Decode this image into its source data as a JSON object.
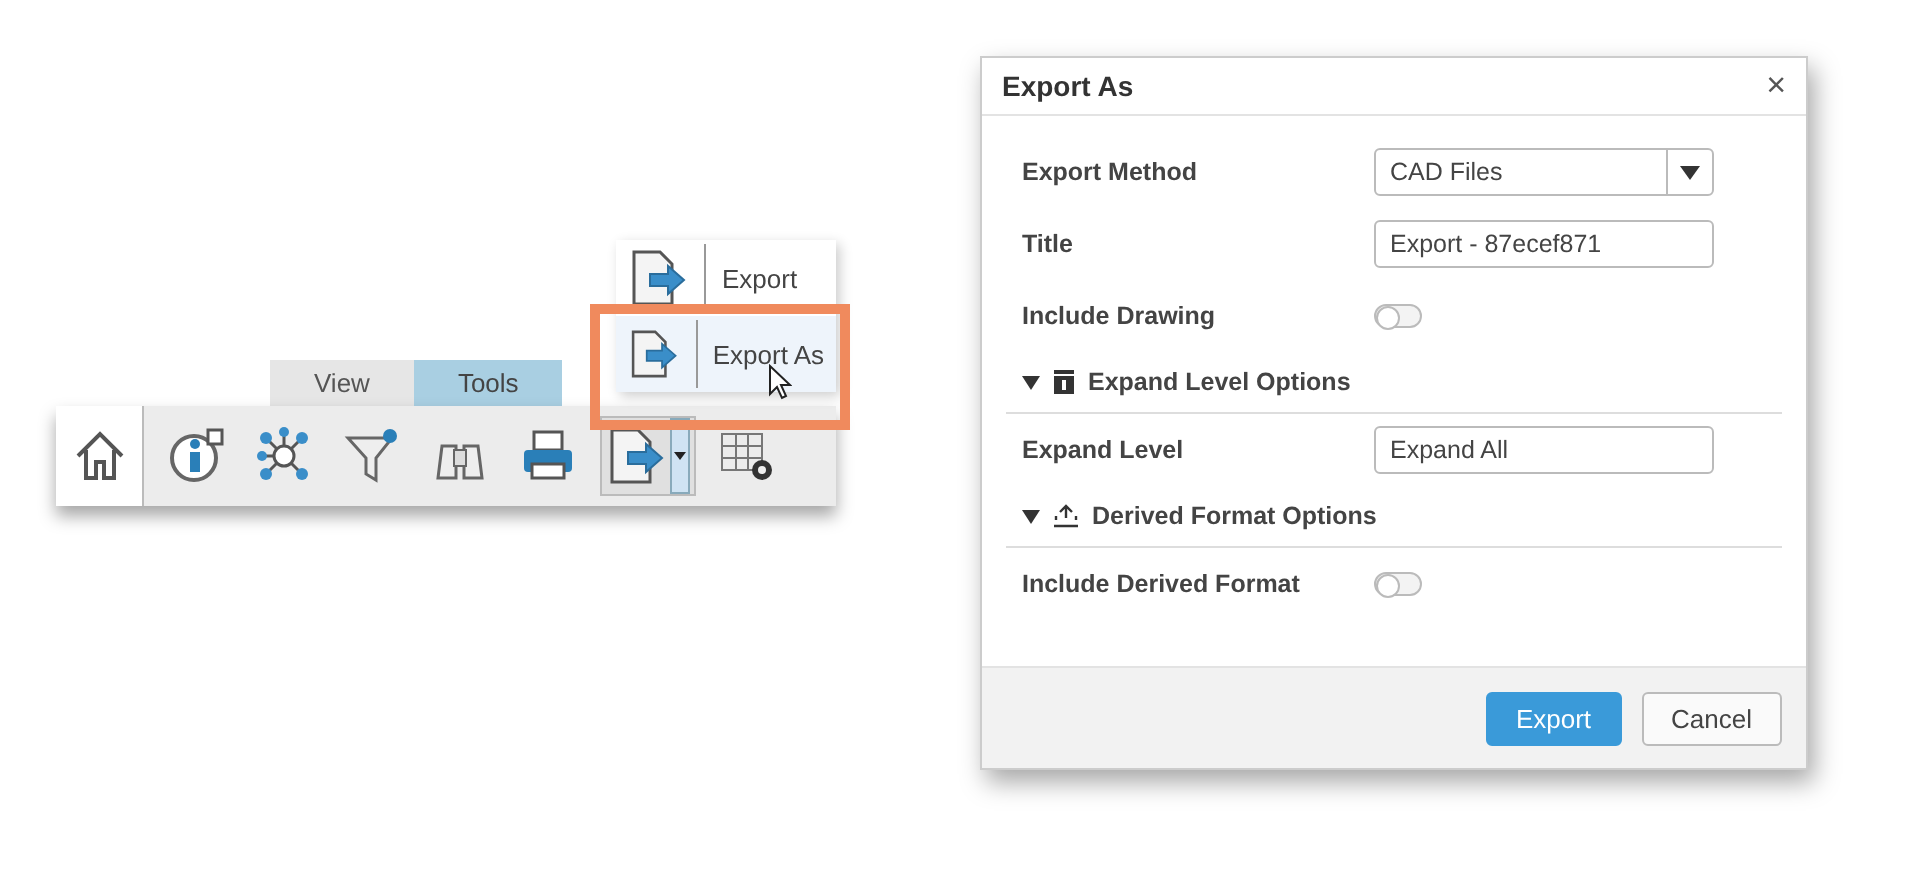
{
  "toolbar": {
    "tabs": [
      {
        "label": "View",
        "selected": false
      },
      {
        "label": "Tools",
        "selected": true
      }
    ],
    "tools": [
      {
        "kind": "home",
        "selected": false
      },
      {
        "kind": "info",
        "selected": false
      },
      {
        "kind": "network",
        "selected": false
      },
      {
        "kind": "filter",
        "selected": false
      },
      {
        "kind": "binoculars",
        "selected": false
      },
      {
        "kind": "print",
        "selected": false
      },
      {
        "kind": "export",
        "selected": true
      },
      {
        "kind": "table-settings",
        "selected": false
      }
    ],
    "menu": [
      {
        "label": "Export",
        "selected": false
      },
      {
        "label": "Export As",
        "selected": true
      }
    ]
  },
  "dialog": {
    "title": "Export As",
    "close": "×",
    "rows": [
      {
        "kind": "select",
        "label": "Export Method",
        "value": "CAD Files"
      },
      {
        "kind": "input",
        "label": "Title",
        "value": "Export - 87ecef871"
      },
      {
        "kind": "toggle",
        "label": "Include Drawing",
        "on": false
      },
      {
        "kind": "section",
        "label": "Expand Level Options",
        "expanded": true
      },
      {
        "kind": "input",
        "label": "Expand Level",
        "value": "Expand All"
      },
      {
        "kind": "section",
        "label": "Derived Format Options",
        "expanded": true
      },
      {
        "kind": "toggle",
        "label": "Include Derived Format",
        "on": false
      }
    ],
    "buttons": [
      {
        "label": "Export",
        "kind": "primary"
      },
      {
        "label": "Cancel",
        "kind": "secondary"
      }
    ]
  }
}
